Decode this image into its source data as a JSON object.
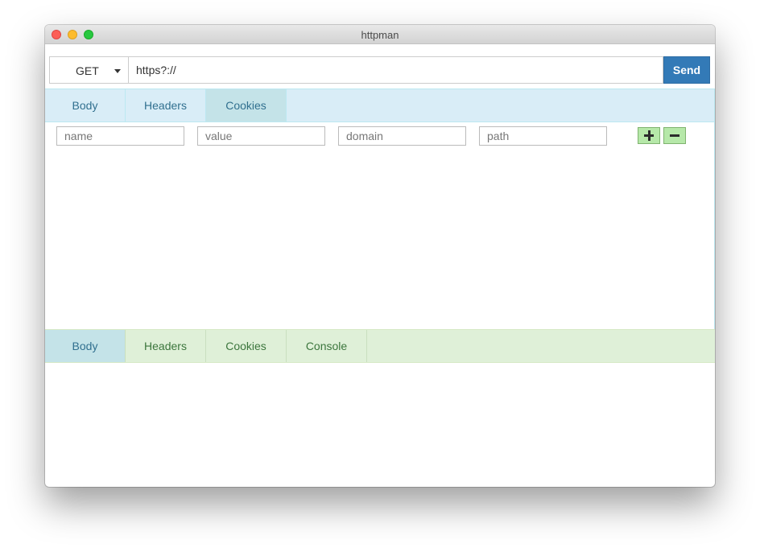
{
  "window": {
    "title": "httpman"
  },
  "request": {
    "method": "GET",
    "url": "https?://",
    "send_label": "Send",
    "tabs": [
      {
        "label": "Body"
      },
      {
        "label": "Headers"
      },
      {
        "label": "Cookies"
      }
    ],
    "active_tab": "Cookies",
    "cookie_fields": {
      "name_placeholder": "name",
      "value_placeholder": "value",
      "domain_placeholder": "domain",
      "path_placeholder": "path"
    }
  },
  "response": {
    "tabs": [
      {
        "label": "Body"
      },
      {
        "label": "Headers"
      },
      {
        "label": "Cookies"
      },
      {
        "label": "Console"
      }
    ],
    "active_tab": "Body"
  },
  "colors": {
    "send_button": "#337ab7",
    "request_tabbar": "#d9edf7",
    "response_tabbar": "#dff0d8",
    "active_tab": "#c4e3e8",
    "add_remove_buttons": "#b6e8a9"
  },
  "icons": {
    "add": "plus-icon",
    "remove": "minus-icon",
    "method_dropdown": "caret-down-icon"
  }
}
